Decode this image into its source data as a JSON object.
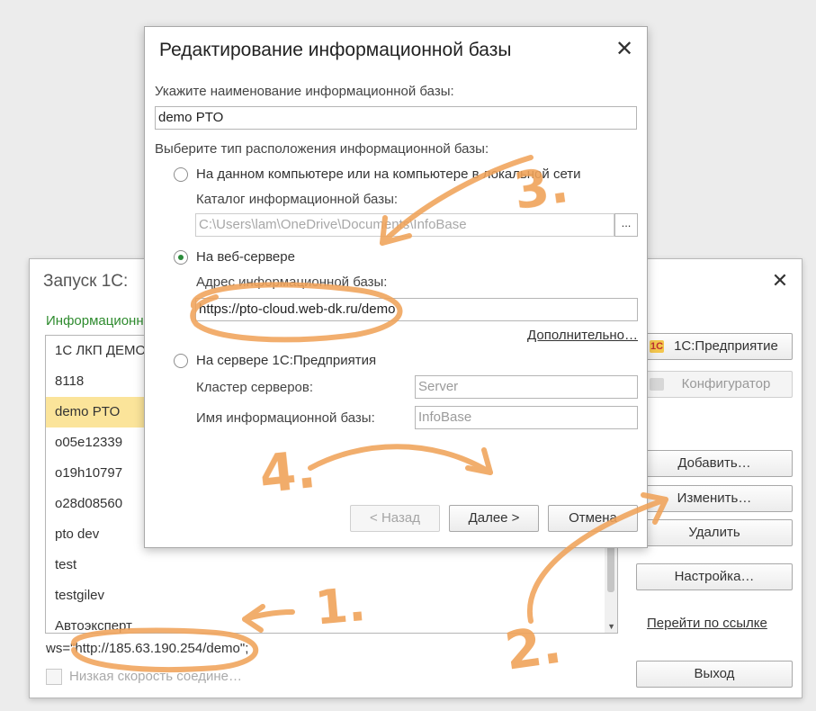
{
  "launcher": {
    "title": "Запуск 1С:",
    "section_label": "Информационн",
    "list_items": [
      "1С ЛКП ДЕМО",
      "8118",
      "demo PTO",
      "o05e12339",
      "o19h10797",
      "o28d08560",
      "pto dev",
      "test",
      "testgilev",
      "Автоэксперт"
    ],
    "selected_index": 2,
    "connection_string": "ws=\"http://185.63.190.254/demo\";",
    "slow_connection_label": "Низкая скорость соедине…",
    "buttons": {
      "enterprise": "1С:Предприятие",
      "designer": "Конфигуратор",
      "add": "Добавить…",
      "edit": "Изменить…",
      "delete": "Удалить",
      "settings": "Настройка…",
      "follow_link": "Перейти по ссылке",
      "exit": "Выход"
    }
  },
  "dialog": {
    "title": "Редактирование информационной базы",
    "name_label": "Укажите наименование информационной базы:",
    "name_value": "demo PTO",
    "location_label": "Выберите тип расположения информационной базы:",
    "option_local": "На данном компьютере или на компьютере в локальной сети",
    "catalog_label": "Каталог информационной базы:",
    "catalog_value": "C:\\Users\\lam\\OneDrive\\Documents\\InfoBase",
    "browse_label": "...",
    "option_web": "На веб-сервере",
    "address_label": "Адрес информационной базы:",
    "address_value": "https://pto-cloud.web-dk.ru/demo",
    "more_link": "Дополнительно…",
    "option_server": "На сервере 1С:Предприятия",
    "cluster_label": "Кластер серверов:",
    "cluster_placeholder": "Server",
    "ibname_label": "Имя информационной базы:",
    "ibname_placeholder": "InfoBase",
    "back_button": "< Назад",
    "next_button": "Далее >",
    "cancel_button": "Отмена",
    "selected_option": "web"
  },
  "annotations": {
    "color": "#f0a35a",
    "labels": [
      "1.",
      "2.",
      "3.",
      "4."
    ]
  }
}
